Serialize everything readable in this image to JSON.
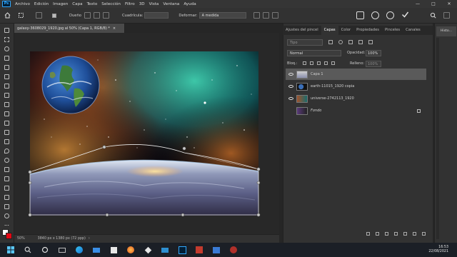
{
  "menubar": {
    "logo": "Ps",
    "items": [
      "Archivo",
      "Edición",
      "Imagen",
      "Capa",
      "Texto",
      "Selección",
      "Filtro",
      "3D",
      "Vista",
      "Ventana",
      "Ayuda"
    ],
    "window_controls": [
      "—",
      "□",
      "✕"
    ]
  },
  "options": {
    "mode_label": "Dueño",
    "cuadricula_label": "Cuadrícula:",
    "deformar_label": "Deformar:",
    "deformar_value": "A medida"
  },
  "document": {
    "tab_title": "galaxy-3608029_1920.jpg al 50% (Capa 1, RGB/8) *",
    "zoom": "50%",
    "size_info": "3840 px x 1380 px (72 ppp)"
  },
  "panels": {
    "tabs": [
      "Ajustes del pincel",
      "Capas",
      "Color",
      "Propiedades",
      "Pinceles",
      "Canales"
    ],
    "active_tab": "Capas",
    "search_placeholder": "Tipo",
    "blend_mode": "Normal",
    "opacity_label": "Opacidad:",
    "opacity_value": "100%",
    "lock_label": "Bloq.:",
    "fill_label": "Relleno:",
    "fill_value": "100%"
  },
  "layers": [
    {
      "name": "Capa 1",
      "selected": true,
      "visible": true
    },
    {
      "name": "earth-11015_1920 copia",
      "selected": false,
      "visible": true
    },
    {
      "name": "universe-2742113_1920",
      "selected": false,
      "visible": true
    },
    {
      "name": "Fondo",
      "selected": false,
      "visible": false,
      "locked": true
    }
  ],
  "side_panel": {
    "tab": "Histo..."
  },
  "taskbar": {
    "time": "16:53",
    "date": "22/08/2021"
  },
  "colors": {
    "accent": "#31a8ff",
    "fg": "#ffffff",
    "bg": "#e30613"
  }
}
